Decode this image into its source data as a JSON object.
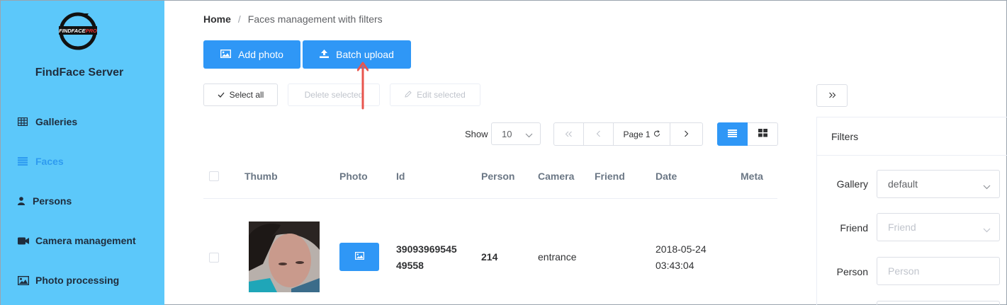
{
  "sidebar": {
    "brand": "FindFace Server",
    "logo_text": "FINDFACEPRO",
    "items": [
      {
        "label": "Galleries",
        "icon": "grid-icon"
      },
      {
        "label": "Faces",
        "icon": "list-icon"
      },
      {
        "label": "Persons",
        "icon": "person-icon"
      },
      {
        "label": "Camera management",
        "icon": "camera-icon"
      },
      {
        "label": "Photo processing",
        "icon": "image-icon"
      }
    ],
    "active": "Faces"
  },
  "breadcrumb": {
    "home": "Home",
    "separator": "/",
    "current": "Faces management with filters"
  },
  "actions": {
    "add_photo": "Add photo",
    "batch_upload": "Batch upload"
  },
  "bulk": {
    "select_all": "Select all",
    "delete_selected": "Delete selected",
    "edit_selected": "Edit selected"
  },
  "paging": {
    "show_label": "Show",
    "page_size": "10",
    "page_label": "Page 1"
  },
  "table": {
    "columns": [
      "Thumb",
      "Photo",
      "Id",
      "Person",
      "Camera",
      "Friend",
      "Date",
      "Meta"
    ],
    "rows": [
      {
        "id_line1": "39093969545",
        "id_line2": "49558",
        "person": "214",
        "camera": "entrance",
        "friend": "",
        "date_line1": "2018-05-24",
        "date_line2": "03:43:04",
        "meta": ""
      }
    ]
  },
  "filters": {
    "title": "Filters",
    "gallery_label": "Gallery",
    "gallery_value": "default",
    "friend_label": "Friend",
    "friend_placeholder": "Friend",
    "person_label": "Person",
    "person_placeholder": "Person"
  },
  "colors": {
    "sidebar": "#5cc8fa",
    "primary": "#2f97f6",
    "active_nav": "#2e9bf0",
    "annotation_arrow": "#e8554e"
  }
}
